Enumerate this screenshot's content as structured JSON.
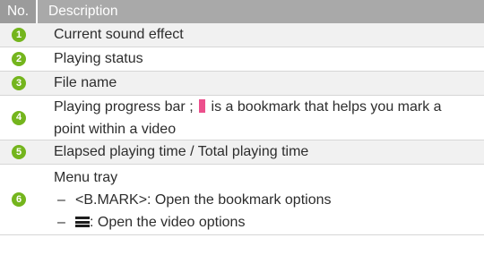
{
  "header": {
    "col_no": "No.",
    "col_desc": "Description"
  },
  "rows": [
    {
      "num": "1",
      "text": "Current sound effect"
    },
    {
      "num": "2",
      "text": "Playing status"
    },
    {
      "num": "3",
      "text": "File name"
    },
    {
      "num": "4",
      "text_before": "Playing progress bar ;",
      "text_after": "is a bookmark that helps you mark a",
      "text_line2": "point within a video",
      "icon": "bookmark-marker-icon",
      "icon_color": "#ec4f8c"
    },
    {
      "num": "5",
      "text": "Elapsed playing time / Total playing time"
    },
    {
      "num": "6",
      "title": "Menu tray",
      "sub1_dash": "–",
      "sub1": "<B.MARK>: Open the bookmark options",
      "sub2_dash": "–",
      "sub2": ": Open the video options",
      "sub2_icon": "menu-icon"
    }
  ],
  "colors": {
    "badge": "#74b51d",
    "header_bg": "#a9a9a9",
    "row_alt_bg": "#f1f1f1"
  }
}
